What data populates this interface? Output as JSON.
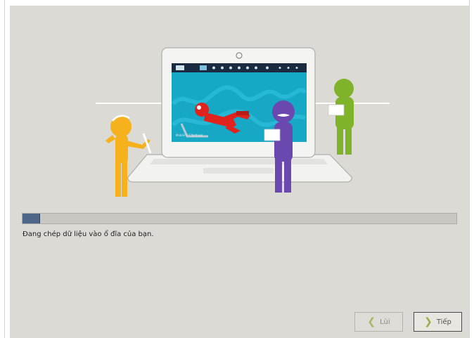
{
  "progress": {
    "value": 0.04
  },
  "status_text": "Đang chép dữ liệu vào ổ đĩa của bạn.",
  "buttons": {
    "back_label": "Lùi",
    "next_label": "Tiếp"
  },
  "icons": {
    "back": "chevron-left-icon",
    "next": "chevron-right-icon"
  },
  "colors": {
    "panel_bg": "#dcdad4",
    "progress_fill": "#4e6789",
    "screen_cyan": "#17a8c6",
    "figure_orange": "#f5b21c",
    "figure_purple": "#6b47b0",
    "figure_green": "#7fb32a",
    "figure_red": "#e0231c"
  }
}
